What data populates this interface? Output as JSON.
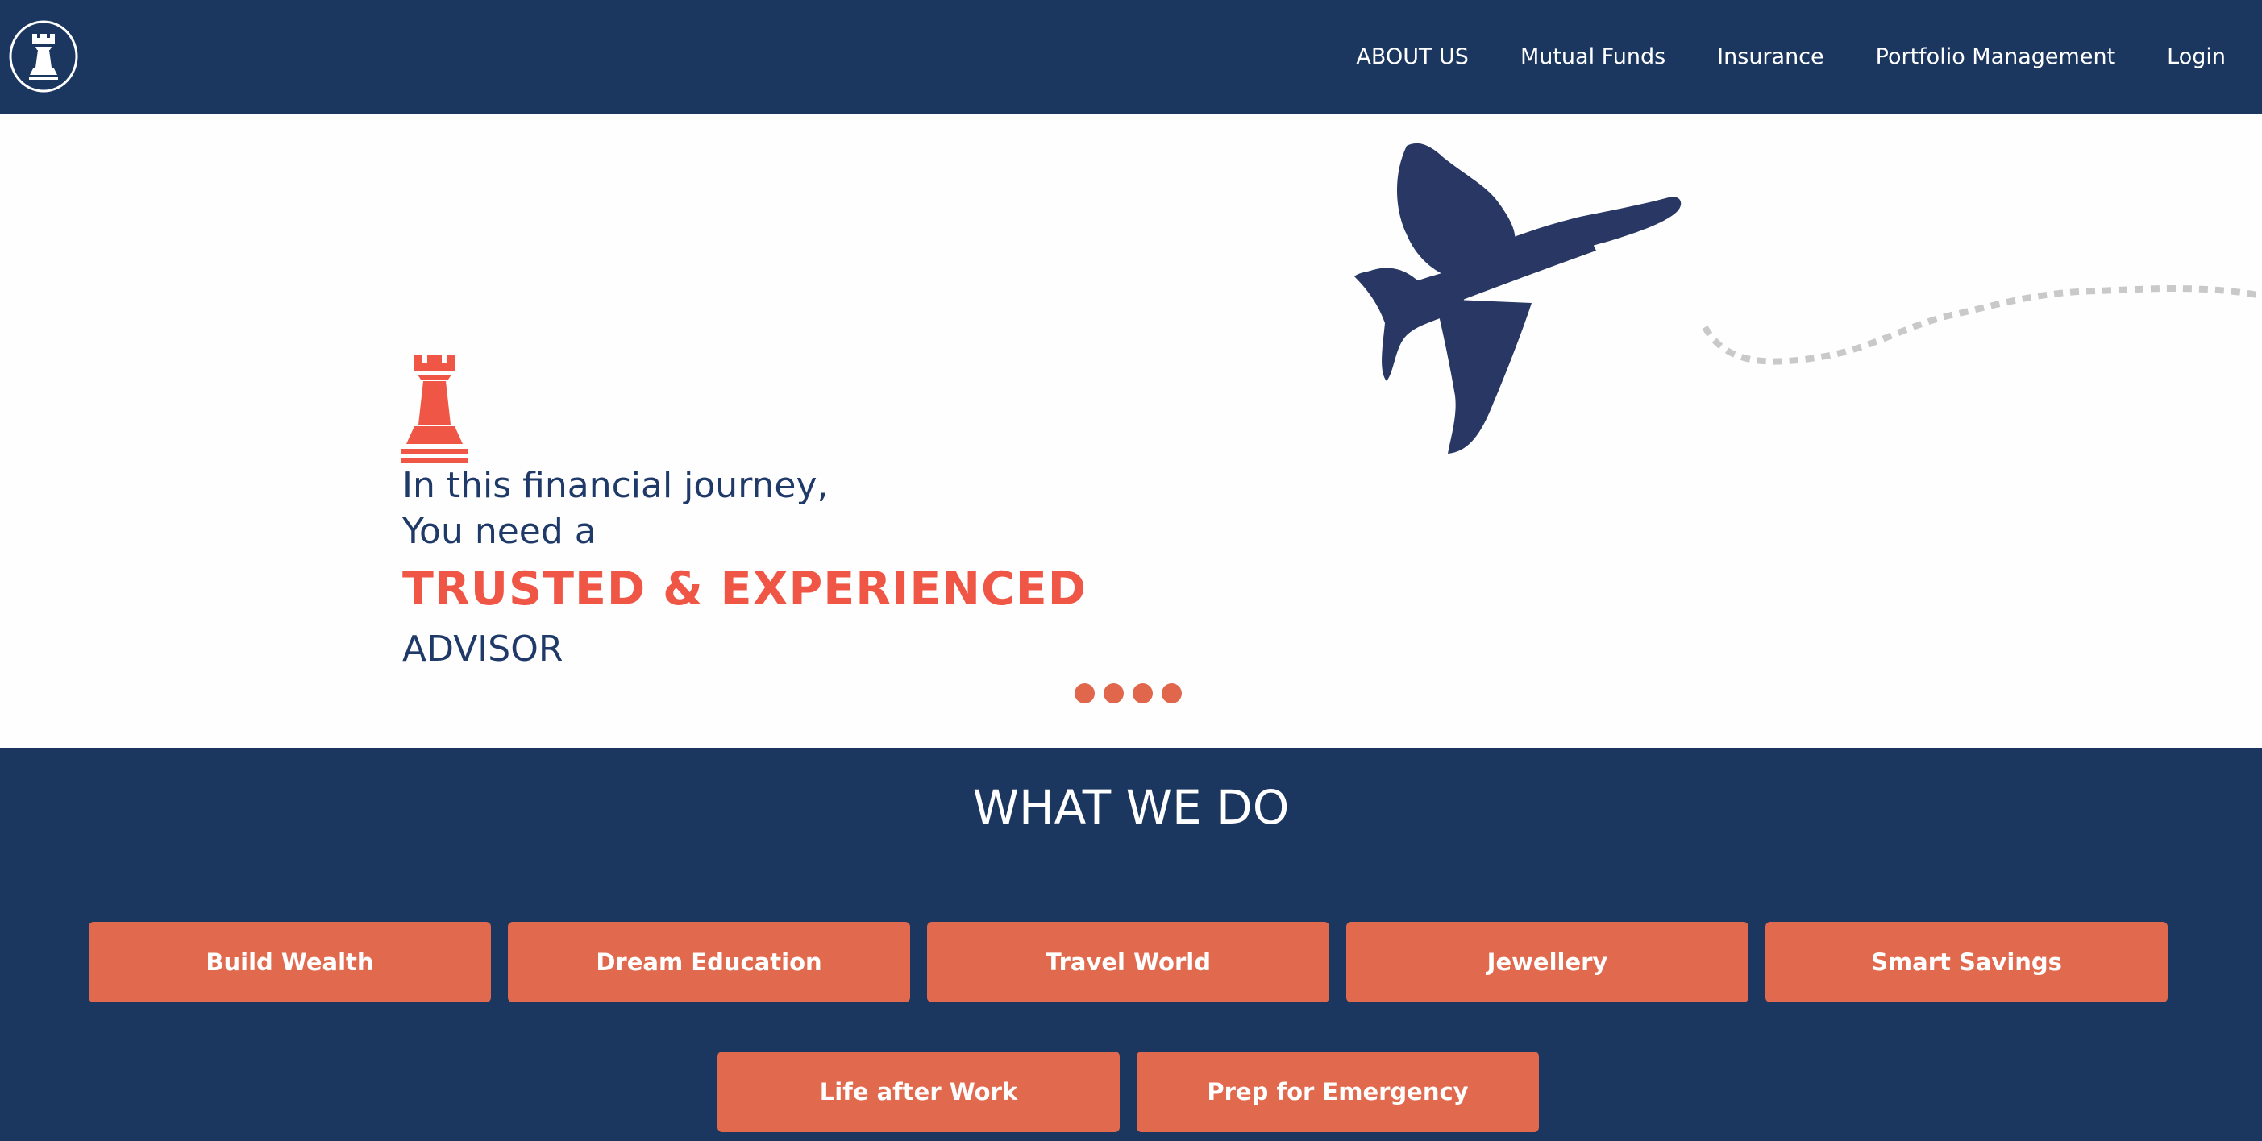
{
  "brand": {
    "logo_icon": "rook-chess-icon"
  },
  "nav": {
    "items": [
      {
        "label": "ABOUT US"
      },
      {
        "label": "Mutual Funds"
      },
      {
        "label": "Insurance"
      },
      {
        "label": "Portfolio Management"
      },
      {
        "label": "Login"
      }
    ]
  },
  "hero": {
    "icon": "rook-chess-icon",
    "illustration": "airplane-icon",
    "line1": "In this financial journey,",
    "line2": "You need a",
    "highlight": "TRUSTED & EXPERIENCED",
    "line4": "ADVISOR",
    "slide_count": 4
  },
  "what_we_do": {
    "title": "WHAT WE DO",
    "services": [
      {
        "label": "Build Wealth"
      },
      {
        "label": "Dream Education"
      },
      {
        "label": "Travel World"
      },
      {
        "label": "Jewellery"
      },
      {
        "label": "Smart Savings"
      },
      {
        "label": "Life after Work"
      },
      {
        "label": "Prep for Emergency"
      }
    ]
  },
  "colors": {
    "navy": "#1b365f",
    "accent_orange": "#e0694e",
    "headline_red": "#ef5646",
    "text_navy": "#1f3a68",
    "plane": "#283763"
  }
}
